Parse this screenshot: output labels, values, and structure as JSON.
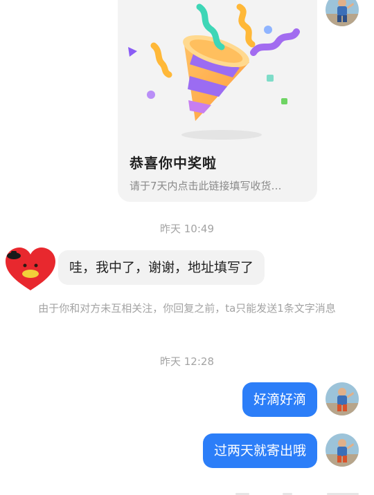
{
  "conversation": {
    "prize_card": {
      "title": "恭喜你中奖啦",
      "description": "请于7天内点击此链接填写收货…"
    },
    "timestamps": [
      "昨天 10:49",
      "昨天 12:28"
    ],
    "messages": [
      {
        "sender": "other",
        "text": "哇，我中了，谢谢，地址填写了"
      },
      {
        "sender": "me",
        "text": "好滴好滴"
      },
      {
        "sender": "me",
        "text": "过两天就寄出哦"
      }
    ],
    "notice": "由于你和对方未互相关注，你回复之前，ta只能发送1条文字消息"
  },
  "colors": {
    "outgoing_bubble": "#2c7ef8",
    "incoming_bubble": "#f2f2f2",
    "card_background": "#f3f3f3",
    "meta_text": "#a3a3a3"
  },
  "icons": {
    "party_popper": "party-popper-icon",
    "self_avatar": "self-avatar",
    "other_avatar": "heart-character-avatar"
  }
}
